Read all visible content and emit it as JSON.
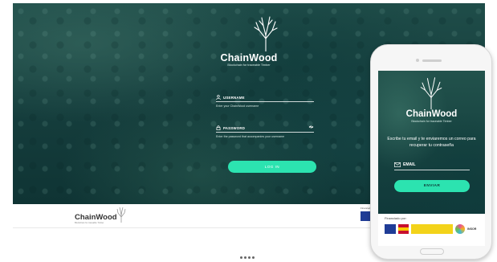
{
  "desktop": {
    "brand_name": "ChainWood",
    "brand_tagline": "Blockchain for traceable Timber",
    "username_label": "USERNAME",
    "username_help": "Enter your ChainWood username",
    "password_label": "PASSWORD",
    "password_help": "Enter the password that accompanies your username",
    "login_button": "LOG IN"
  },
  "footer": {
    "brand_name": "ChainWood",
    "brand_tagline": "Blockchain for traceable Timber",
    "funded_label": "Financed by"
  },
  "mobile": {
    "brand_name": "ChainWood",
    "brand_tagline": "Blockchain for traceable Timber",
    "message": "Escribe tu email y te enviaremos un correo para recuperar tu contraseña",
    "email_label": "EMAIL",
    "send_button": "ENVIAR",
    "funded_label": "Financiado por:",
    "partner_logo_text": "INSOR"
  },
  "colors": {
    "accent": "#2ce3b0",
    "forest_dark": "#10393a",
    "forest_mid": "#1f4d49"
  },
  "icons": {
    "brand": "tree-icon",
    "username": "user-icon",
    "password": "lock-icon",
    "visibility": "eye-icon",
    "email": "envelope-icon"
  }
}
